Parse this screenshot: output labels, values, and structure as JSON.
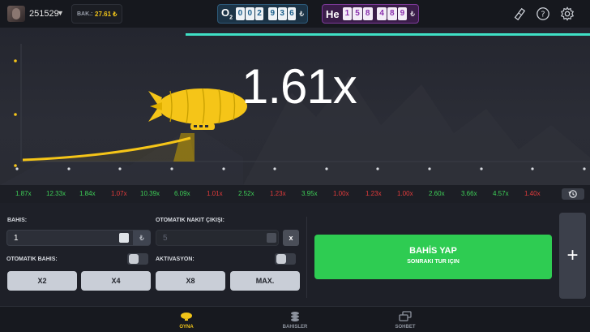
{
  "header": {
    "user_id": "251529",
    "balance_label": "BAK.:",
    "balance_value": "27.61 ₺",
    "o2_label": "O",
    "o2_sub": "2",
    "o2_digits": [
      "0",
      "0",
      "2",
      "9",
      "3",
      "6"
    ],
    "he_label": "He",
    "he_digits": [
      "1",
      "5",
      "8",
      "4",
      "8",
      "9"
    ],
    "currency_symbol": "₺",
    "icons": [
      "ticket-icon",
      "help-icon",
      "settings-icon"
    ]
  },
  "game": {
    "multiplier": "1.61x",
    "accent": "#3fe0c5",
    "curve_color": "#f5c518"
  },
  "history": [
    {
      "value": "1.87x",
      "color": "#3ecf57"
    },
    {
      "value": "12.33x",
      "color": "#3ecf57"
    },
    {
      "value": "1.84x",
      "color": "#3ecf57"
    },
    {
      "value": "1.07x",
      "color": "#e53b3b"
    },
    {
      "value": "10.39x",
      "color": "#3ecf57"
    },
    {
      "value": "6.09x",
      "color": "#3ecf57"
    },
    {
      "value": "1.01x",
      "color": "#e53b3b"
    },
    {
      "value": "2.52x",
      "color": "#3ecf57"
    },
    {
      "value": "1.23x",
      "color": "#e53b3b"
    },
    {
      "value": "3.95x",
      "color": "#3ecf57"
    },
    {
      "value": "1.00x",
      "color": "#e53b3b"
    },
    {
      "value": "1.23x",
      "color": "#e53b3b"
    },
    {
      "value": "1.00x",
      "color": "#e53b3b"
    },
    {
      "value": "2.60x",
      "color": "#3ecf57"
    },
    {
      "value": "3.66x",
      "color": "#3ecf57"
    },
    {
      "value": "4.57x",
      "color": "#3ecf57"
    },
    {
      "value": "1.40x",
      "color": "#e53b3b"
    }
  ],
  "bet": {
    "bet_label": "BAHIS:",
    "bet_value": "1",
    "auto_cashout_label": "OTOMATIK NAKIT ÇIKIŞI:",
    "auto_cashout_placeholder": "5",
    "auto_cashout_clear": "x",
    "auto_bet_label": "OTOMATIK BAHIS:",
    "activation_label": "AKTIVASYON:",
    "quick_buttons": [
      "X2",
      "X4",
      "X8",
      "MAX."
    ],
    "place_bet_label": "BAHİS YAP",
    "place_bet_sub": "SONRAKI TUR IÇIN",
    "add_panel": "+",
    "bet_color": "#2ecc52"
  },
  "nav": {
    "play": "OYNA",
    "bets": "BAHISLER",
    "chat": "SOHBET",
    "active_color": "#f0c419"
  }
}
